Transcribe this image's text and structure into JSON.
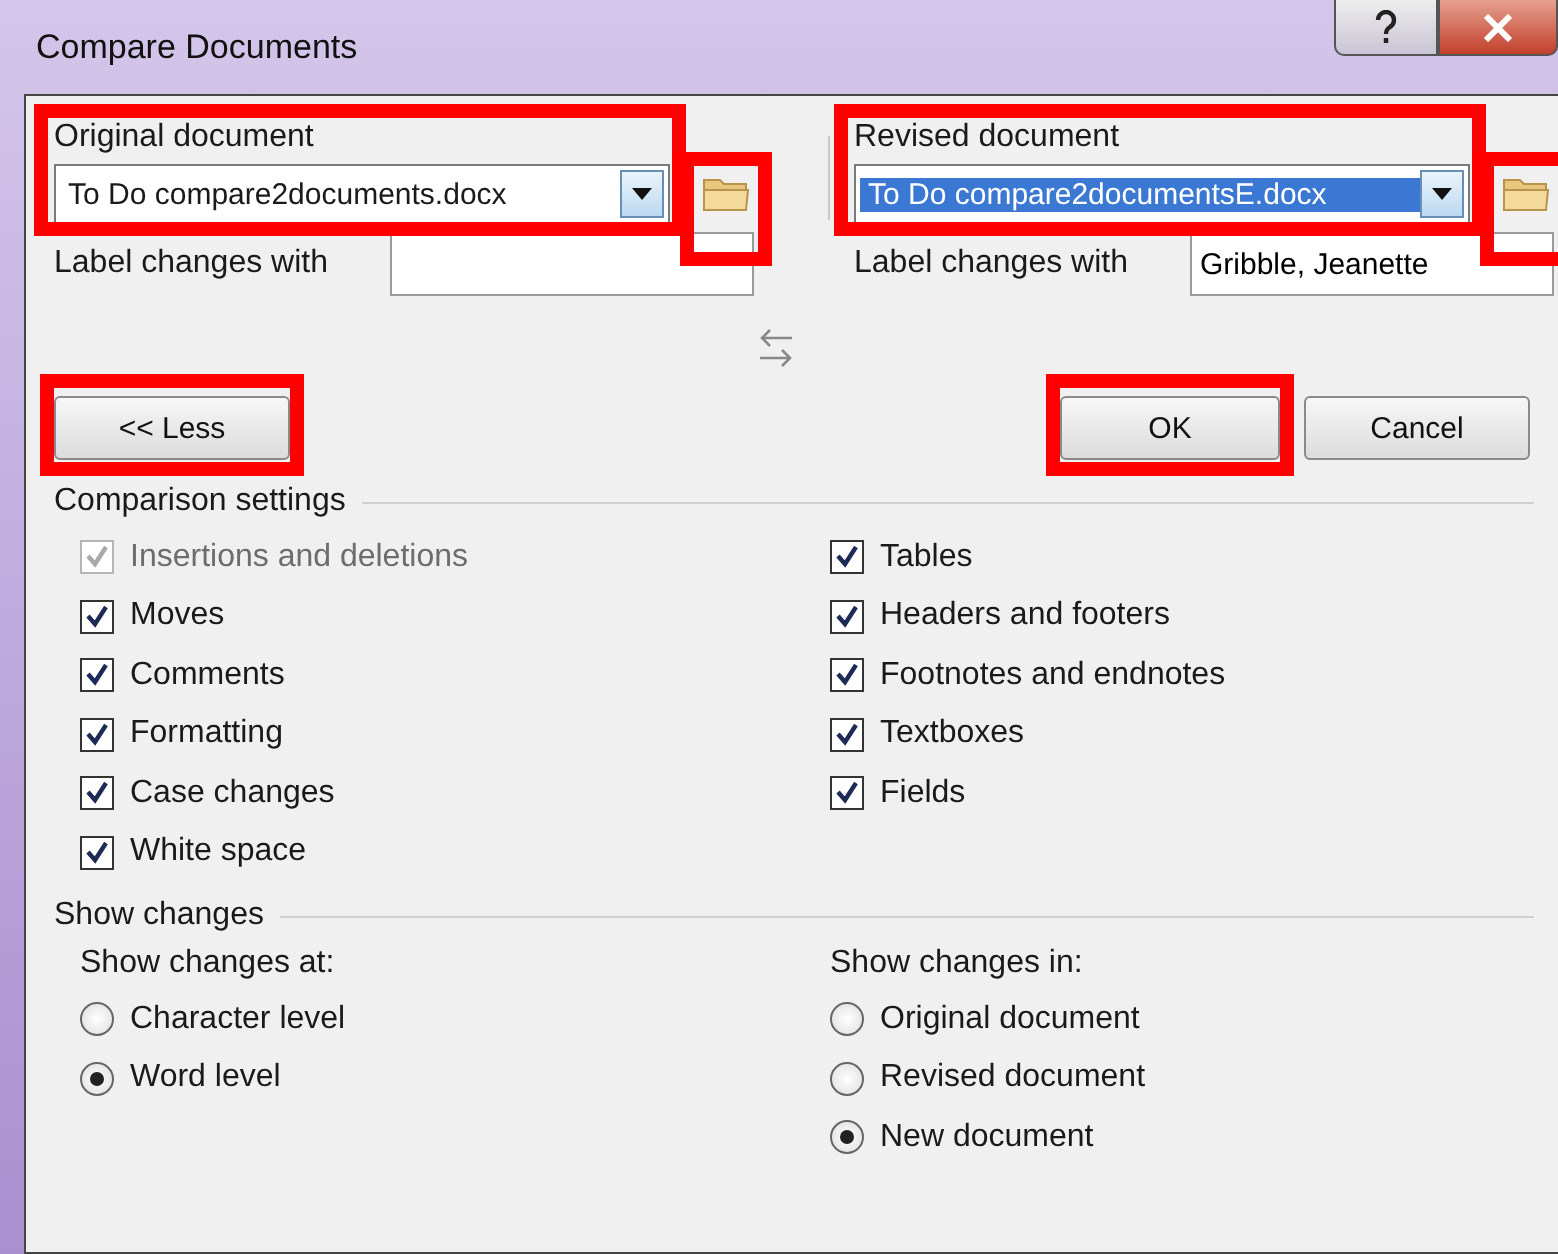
{
  "window": {
    "title": "Compare Documents"
  },
  "documents": [
    {
      "heading": "Original document",
      "file": "To Do compare2documents.docx",
      "file_selected": false,
      "highlighted": true,
      "browse_highlighted": true,
      "label_caption": "Label changes with"
    },
    {
      "heading": "Revised document",
      "file": "To Do compare2documentsE.docx",
      "file_selected": true,
      "highlighted": true,
      "browse_highlighted": true,
      "label_caption": "Label changes with",
      "label_value": "Gribble, Jeanette"
    }
  ],
  "buttons": [
    {
      "label": "<< Less",
      "highlighted": true
    },
    {
      "label": "OK",
      "highlighted": true
    },
    {
      "label": "Cancel",
      "highlighted": false
    }
  ],
  "comparison_settings": {
    "title": "Comparison settings",
    "columns": [
      [
        {
          "label": "Insertions and deletions",
          "checked": true,
          "disabled": true
        },
        {
          "label": "Moves",
          "checked": true,
          "disabled": false
        },
        {
          "label": "Comments",
          "checked": true,
          "disabled": false
        },
        {
          "label": "Formatting",
          "checked": true,
          "disabled": false
        },
        {
          "label": "Case changes",
          "checked": true,
          "disabled": false
        },
        {
          "label": "White space",
          "checked": true,
          "disabled": false
        }
      ],
      [
        {
          "label": "Tables",
          "checked": true,
          "disabled": false
        },
        {
          "label": "Headers and footers",
          "checked": true,
          "disabled": false
        },
        {
          "label": "Footnotes and endnotes",
          "checked": true,
          "disabled": false
        },
        {
          "label": "Textboxes",
          "checked": true,
          "disabled": false
        },
        {
          "label": "Fields",
          "checked": true,
          "disabled": false
        }
      ]
    ]
  },
  "show_changes": {
    "title": "Show changes",
    "groups": [
      {
        "title": "Show changes at:",
        "options": [
          {
            "label": "Character level",
            "selected": false
          },
          {
            "label": "Word level",
            "selected": true
          }
        ]
      },
      {
        "title": "Show changes in:",
        "options": [
          {
            "label": "Original document",
            "selected": false
          },
          {
            "label": "Revised document",
            "selected": false
          },
          {
            "label": "New document",
            "selected": true
          }
        ]
      }
    ]
  }
}
